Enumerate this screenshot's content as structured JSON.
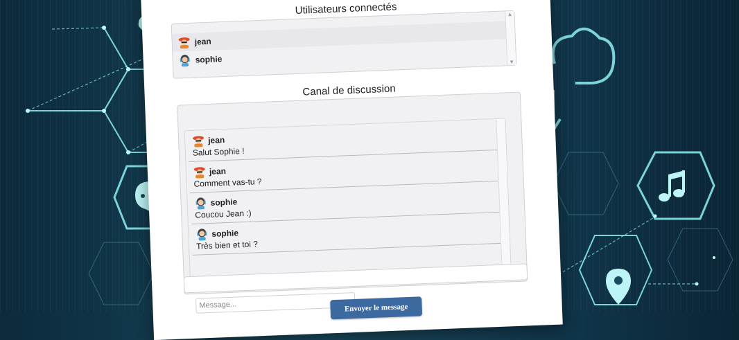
{
  "users_panel": {
    "title": "Utilisateurs connectés",
    "users": [
      {
        "name": "jean",
        "avatar": "firefighter-avatar-icon"
      },
      {
        "name": "sophie",
        "avatar": "headset-girl-avatar-icon"
      }
    ]
  },
  "chat_panel": {
    "title": "Canal de discussion",
    "messages": [
      {
        "author": "jean",
        "avatar": "firefighter-avatar-icon",
        "text": "Salut Sophie !"
      },
      {
        "author": "jean",
        "avatar": "firefighter-avatar-icon",
        "text": "Comment vas-tu ?"
      },
      {
        "author": "sophie",
        "avatar": "headset-girl-avatar-icon",
        "text": "Coucou Jean :)"
      },
      {
        "author": "sophie",
        "avatar": "headset-girl-avatar-icon",
        "text": "Très bien et toi ?"
      }
    ]
  },
  "composer": {
    "placeholder": "Message...",
    "send_label": "Envoyer le message"
  },
  "colors": {
    "accent": "#3c6aa0",
    "background": "#123a4f",
    "line_glow": "#8ff0f2"
  }
}
